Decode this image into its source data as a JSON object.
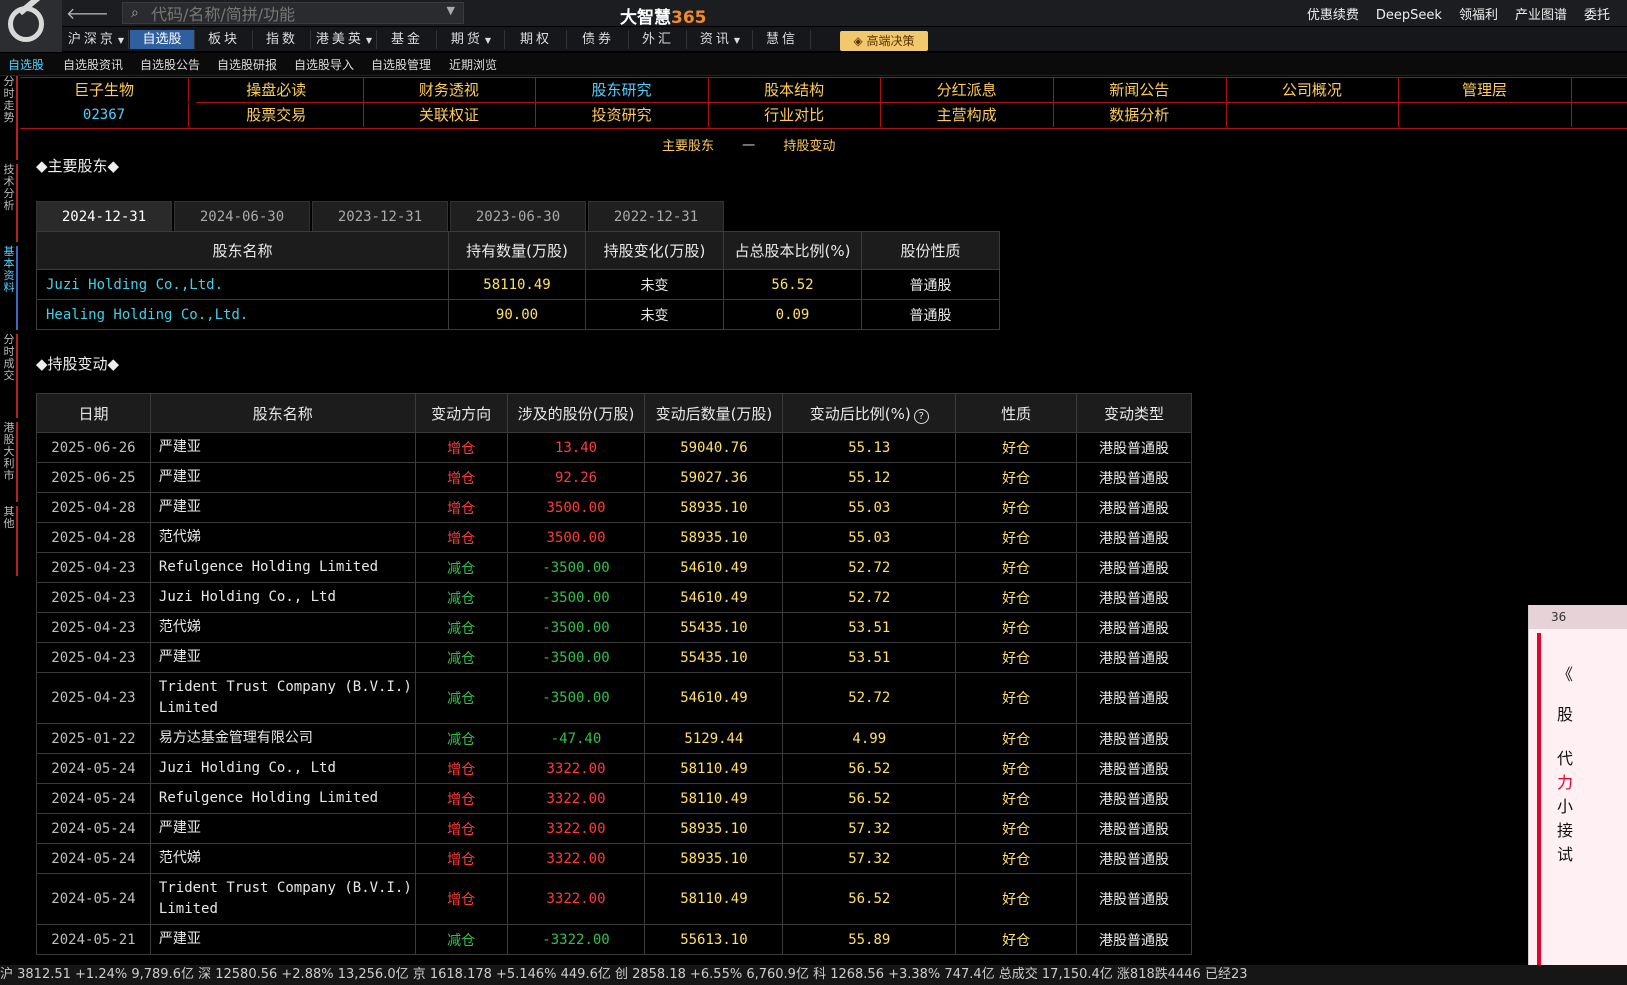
{
  "app": {
    "title_main": "大智慧",
    "title_num": "365"
  },
  "search": {
    "placeholder": "代码/名称/简拼/功能"
  },
  "top_links": [
    "优惠续费",
    "DeepSeek",
    "领福利",
    "产业图谱",
    "委托"
  ],
  "menu": [
    {
      "label": "沪深京",
      "caret": true
    },
    {
      "label": "自选股",
      "active": true
    },
    {
      "label": "板块"
    },
    {
      "label": "指数"
    },
    {
      "label": "港美英",
      "caret": true
    },
    {
      "label": "基金"
    },
    {
      "label": "期货",
      "caret": true
    },
    {
      "label": "期权"
    },
    {
      "label": "债券"
    },
    {
      "label": "外汇"
    },
    {
      "label": "资讯",
      "caret": true
    },
    {
      "label": "慧信"
    }
  ],
  "gold_button": "高端决策",
  "strip": [
    "自选股",
    "自选股资讯",
    "自选股公告",
    "自选股研报",
    "自选股导入",
    "自选股管理",
    "近期浏览"
  ],
  "side_tabs": [
    "分时走势",
    "技术分析",
    "基本资料",
    "分时成交",
    "港股大利市",
    "其他"
  ],
  "stock": {
    "name": "巨子生物",
    "code": "02367"
  },
  "nav_row1": [
    "操盘必读",
    "财务透视",
    "股东研究",
    "股本结构",
    "分红派息",
    "新闻公告",
    "公司概况",
    "管理层"
  ],
  "nav_row2": [
    "股票交易",
    "关联权证",
    "投资研究",
    "行业对比",
    "主营构成",
    "数据分析"
  ],
  "subnav": {
    "a": "主要股东",
    "sep": "一",
    "b": "持股变动"
  },
  "section1": "◆主要股东◆",
  "section2": "◆持股变动◆",
  "date_tabs": [
    "2024-12-31",
    "2024-06-30",
    "2023-12-31",
    "2023-06-30",
    "2022-12-31"
  ],
  "holders": {
    "columns": [
      "股东名称",
      "持有数量(万股)",
      "持股变化(万股)",
      "占总股本比例(%)",
      "股份性质"
    ],
    "rows": [
      [
        "Juzi Holding Co.,Ltd.",
        "58110.49",
        "未变",
        "56.52",
        "普通股"
      ],
      [
        "Healing Holding Co.,Ltd.",
        "90.00",
        "未变",
        "0.09",
        "普通股"
      ]
    ]
  },
  "changes": {
    "columns": [
      "日期",
      "股东名称",
      "变动方向",
      "涉及的股份(万股)",
      "变动后数量(万股)",
      "变动后比例(%)",
      "性质",
      "变动类型"
    ],
    "help_icon": "?",
    "rows": [
      [
        "2025-06-26",
        "严建亚",
        "增仓",
        "13.40",
        "59040.76",
        "55.13",
        "好仓",
        "港股普通股"
      ],
      [
        "2025-06-25",
        "严建亚",
        "增仓",
        "92.26",
        "59027.36",
        "55.12",
        "好仓",
        "港股普通股"
      ],
      [
        "2025-04-28",
        "严建亚",
        "增仓",
        "3500.00",
        "58935.10",
        "55.03",
        "好仓",
        "港股普通股"
      ],
      [
        "2025-04-28",
        "范代娣",
        "增仓",
        "3500.00",
        "58935.10",
        "55.03",
        "好仓",
        "港股普通股"
      ],
      [
        "2025-04-23",
        "Refulgence Holding Limited",
        "减仓",
        "-3500.00",
        "54610.49",
        "52.72",
        "好仓",
        "港股普通股"
      ],
      [
        "2025-04-23",
        "Juzi Holding Co., Ltd",
        "减仓",
        "-3500.00",
        "54610.49",
        "52.72",
        "好仓",
        "港股普通股"
      ],
      [
        "2025-04-23",
        "范代娣",
        "减仓",
        "-3500.00",
        "55435.10",
        "53.51",
        "好仓",
        "港股普通股"
      ],
      [
        "2025-04-23",
        "严建亚",
        "减仓",
        "-3500.00",
        "55435.10",
        "53.51",
        "好仓",
        "港股普通股"
      ],
      [
        "2025-04-23",
        "Trident Trust Company (B.V.I.) Limited",
        "减仓",
        "-3500.00",
        "54610.49",
        "52.72",
        "好仓",
        "港股普通股"
      ],
      [
        "2025-01-22",
        "易方达基金管理有限公司",
        "减仓",
        "-47.40",
        "5129.44",
        "4.99",
        "好仓",
        "港股普通股"
      ],
      [
        "2024-05-24",
        "Juzi Holding Co., Ltd",
        "增仓",
        "3322.00",
        "58110.49",
        "56.52",
        "好仓",
        "港股普通股"
      ],
      [
        "2024-05-24",
        "Refulgence Holding Limited",
        "增仓",
        "3322.00",
        "58110.49",
        "56.52",
        "好仓",
        "港股普通股"
      ],
      [
        "2024-05-24",
        "严建亚",
        "增仓",
        "3322.00",
        "58935.10",
        "57.32",
        "好仓",
        "港股普通股"
      ],
      [
        "2024-05-24",
        "范代娣",
        "增仓",
        "3322.00",
        "58935.10",
        "57.32",
        "好仓",
        "港股普通股"
      ],
      [
        "2024-05-24",
        "Trident Trust Company (B.V.I.) Limited",
        "增仓",
        "3322.00",
        "58110.49",
        "56.52",
        "好仓",
        "港股普通股"
      ],
      [
        "2024-05-21",
        "严建亚",
        "减仓",
        "-3322.00",
        "55613.10",
        "55.89",
        "好仓",
        "港股普通股"
      ]
    ]
  },
  "float_panel": {
    "lines": [
      "《",
      "股",
      "代",
      "力",
      "小",
      "接",
      "试"
    ],
    "badge": "36"
  },
  "ticker": "沪 3812.51 +1.24% 9,789.6亿 深 12580.56 +2.88% 13,256.0亿 京 1618.178 +5.146% 449.6亿 创 2858.18 +6.55% 6,760.9亿 科 1268.56 +3.38% 747.4亿 总成交 17,150.4亿 涨818跌4446 已经23"
}
